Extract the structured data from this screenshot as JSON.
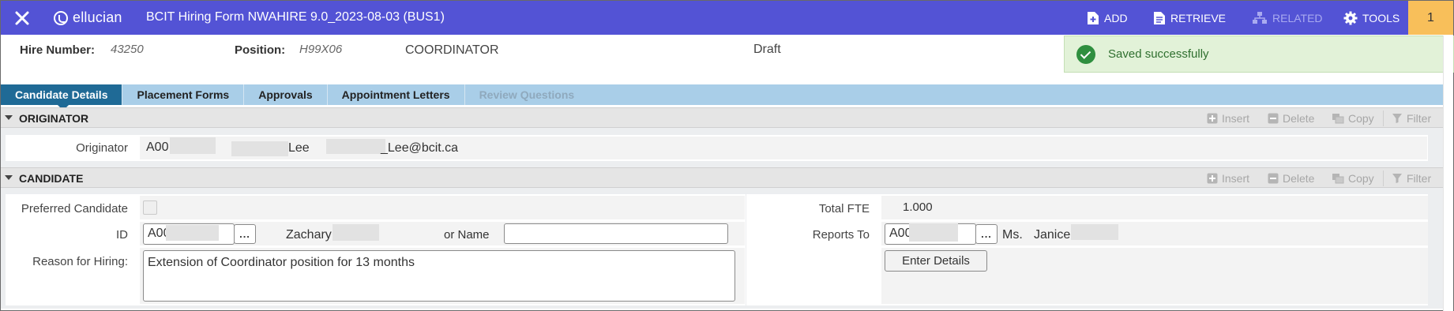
{
  "topbar": {
    "brand": "ellucian",
    "title": "BCIT Hiring Form NWAHIRE 9.0_2023-08-03 (BUS1)",
    "add_label": "ADD",
    "retrieve_label": "RETRIEVE",
    "related_label": "RELATED",
    "tools_label": "TOOLS",
    "notification_count": "1"
  },
  "header": {
    "hire_number_label": "Hire Number:",
    "hire_number_value": "43250",
    "position_label": "Position:",
    "position_code": "H99X06",
    "position_title": "COORDINATOR",
    "status": "Draft"
  },
  "toast": {
    "message": "Saved successfully"
  },
  "tabs": [
    {
      "label": "Candidate Details",
      "state": "active"
    },
    {
      "label": "Placement Forms",
      "state": "normal"
    },
    {
      "label": "Approvals",
      "state": "normal"
    },
    {
      "label": "Appointment Letters",
      "state": "normal"
    },
    {
      "label": "Review Questions",
      "state": "disabled"
    }
  ],
  "section_actions": {
    "insert": "Insert",
    "delete": "Delete",
    "copy": "Copy",
    "filter": "Filter"
  },
  "originator": {
    "section_title": "ORIGINATOR",
    "label": "Originator",
    "id_prefix": "A00",
    "last_name": "Lee",
    "email_suffix": "_Lee@bcit.ca"
  },
  "candidate": {
    "section_title": "CANDIDATE",
    "preferred_label": "Preferred Candidate",
    "id_label": "ID",
    "id_value": "A00",
    "first_name": "Zachary",
    "or_name_label": "or Name",
    "or_name_value": "",
    "reason_label": "Reason for Hiring:",
    "reason_value": "Extension of Coordinator position for 13 months",
    "total_fte_label": "Total FTE",
    "total_fte_value": "1.000",
    "reports_to_label": "Reports To",
    "reports_to_id": "A00",
    "reports_to_title": "Ms.",
    "reports_to_first_name": "Janice",
    "enter_details_label": "Enter Details",
    "lookup_label": "..."
  },
  "colors": {
    "topbar": "#5353d5",
    "notification": "#f8bf5a",
    "tab_active": "#1f6a96",
    "tab_bar": "#a9cee8",
    "toast_bg": "#e2f2d8",
    "toast_icon": "#2f8f3f"
  },
  "icons": [
    "close-icon",
    "ellucian-logo-icon",
    "add-page-icon",
    "retrieve-document-icon",
    "related-icon",
    "gear-icon",
    "plus-box-icon",
    "minus-box-icon",
    "copy-icon",
    "filter-icon",
    "checkmark-circle-icon",
    "collapse-triangle-icon"
  ]
}
